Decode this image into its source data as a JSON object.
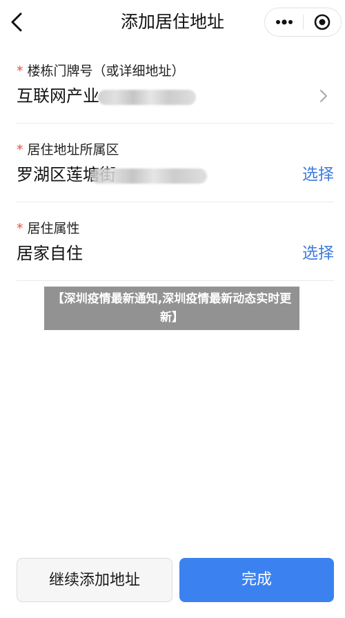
{
  "nav": {
    "title": "添加居住地址",
    "back_icon": "chevron-left-icon",
    "more_icon": "more-dots-icon",
    "target_icon": "target-icon"
  },
  "fields": [
    {
      "required_mark": "*",
      "label": "楼栋门牌号（或详细地址）",
      "value": "互联网产业",
      "action_icon": "chevron-right-icon"
    },
    {
      "required_mark": "*",
      "label": "居住地址所属区",
      "value": "罗湖区莲塘街",
      "action": "选择"
    },
    {
      "required_mark": "*",
      "label": "居住属性",
      "value": "居家自住",
      "action": "选择"
    }
  ],
  "banner": {
    "text": "【深圳疫情最新通知,深圳疫情最新动态实时更新】"
  },
  "buttons": {
    "continue": "继续添加地址",
    "done": "完成"
  },
  "colors": {
    "accent": "#3b82f0",
    "link": "#3c7be0",
    "required": "#f04b3a"
  }
}
